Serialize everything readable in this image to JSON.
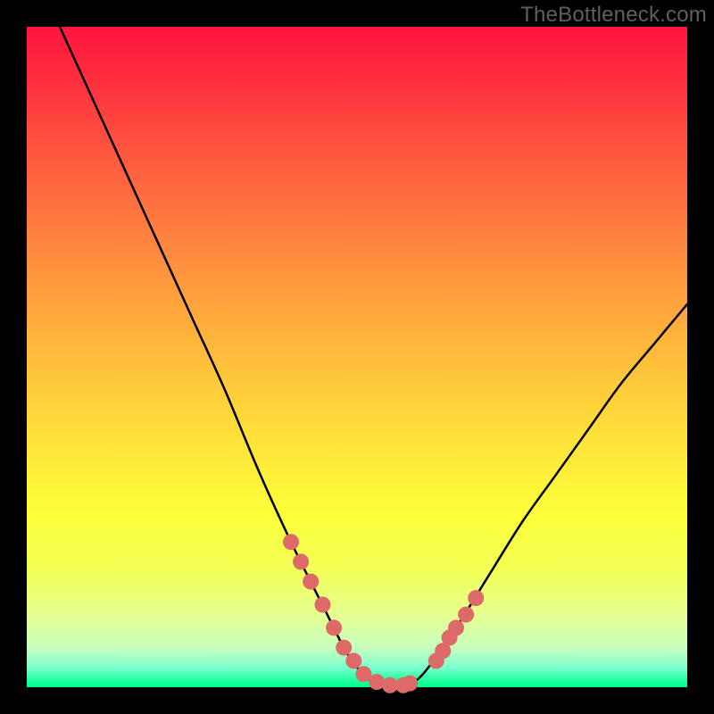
{
  "watermark": "TheBottleneck.com",
  "colors": {
    "frame": "#000000",
    "curve": "#000000",
    "dot": "#dd6969",
    "gradient_top": "#ff153e",
    "gradient_bottom": "#00ff86"
  },
  "chart_data": {
    "type": "line",
    "title": "",
    "xlabel": "",
    "ylabel": "",
    "xlim": [
      0,
      100
    ],
    "ylim": [
      0,
      100
    ],
    "series": [
      {
        "name": "bottleneck-curve",
        "x": [
          5,
          10,
          15,
          20,
          25,
          30,
          35,
          40,
          45,
          48,
          50,
          52,
          55,
          57,
          60,
          65,
          70,
          75,
          80,
          85,
          90,
          95,
          100
        ],
        "y": [
          100,
          89,
          78,
          67,
          56,
          45,
          33,
          22,
          12,
          6,
          3,
          1,
          0,
          0,
          2,
          9,
          17,
          25,
          32,
          39,
          46,
          52,
          58
        ]
      }
    ],
    "highlight_points": {
      "name": "marker-dots",
      "x": [
        40,
        41.5,
        43,
        44.8,
        46.5,
        48,
        49.5,
        51,
        53,
        55,
        57,
        58,
        62,
        63,
        64,
        65,
        66.5,
        68
      ],
      "y": [
        22,
        19,
        16,
        12.5,
        9,
        6,
        4,
        2,
        0.8,
        0.3,
        0.3,
        0.6,
        4,
        5.5,
        7.5,
        9,
        11,
        13.5
      ]
    }
  }
}
